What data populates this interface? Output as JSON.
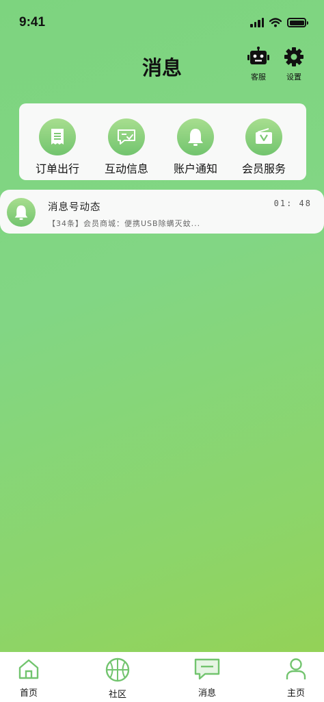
{
  "status_bar": {
    "time": "9:41"
  },
  "header": {
    "title": "消息",
    "service_label": "客服",
    "settings_label": "设置"
  },
  "categories": [
    {
      "label": "订单出行",
      "icon": "receipt-icon"
    },
    {
      "label": "互动信息",
      "icon": "chat-check-icon"
    },
    {
      "label": "账户通知",
      "icon": "bell-icon"
    },
    {
      "label": "会员服务",
      "icon": "vip-bag-icon"
    }
  ],
  "messages": [
    {
      "title": "消息号动态",
      "time": "01: 48",
      "preview": "【34条】会员商城：便携USB除螨灭蚊...",
      "icon": "bell-icon"
    }
  ],
  "tabbar": {
    "items": [
      {
        "label": "首页",
        "icon": "home-icon"
      },
      {
        "label": "社区",
        "icon": "basketball-icon"
      },
      {
        "label": "消息",
        "icon": "message-icon"
      },
      {
        "label": "主页",
        "icon": "user-icon"
      }
    ]
  },
  "colors": {
    "accent": "#7dd47f",
    "icon_green": "#72c46e",
    "card_bg": "#f8f9f8"
  }
}
